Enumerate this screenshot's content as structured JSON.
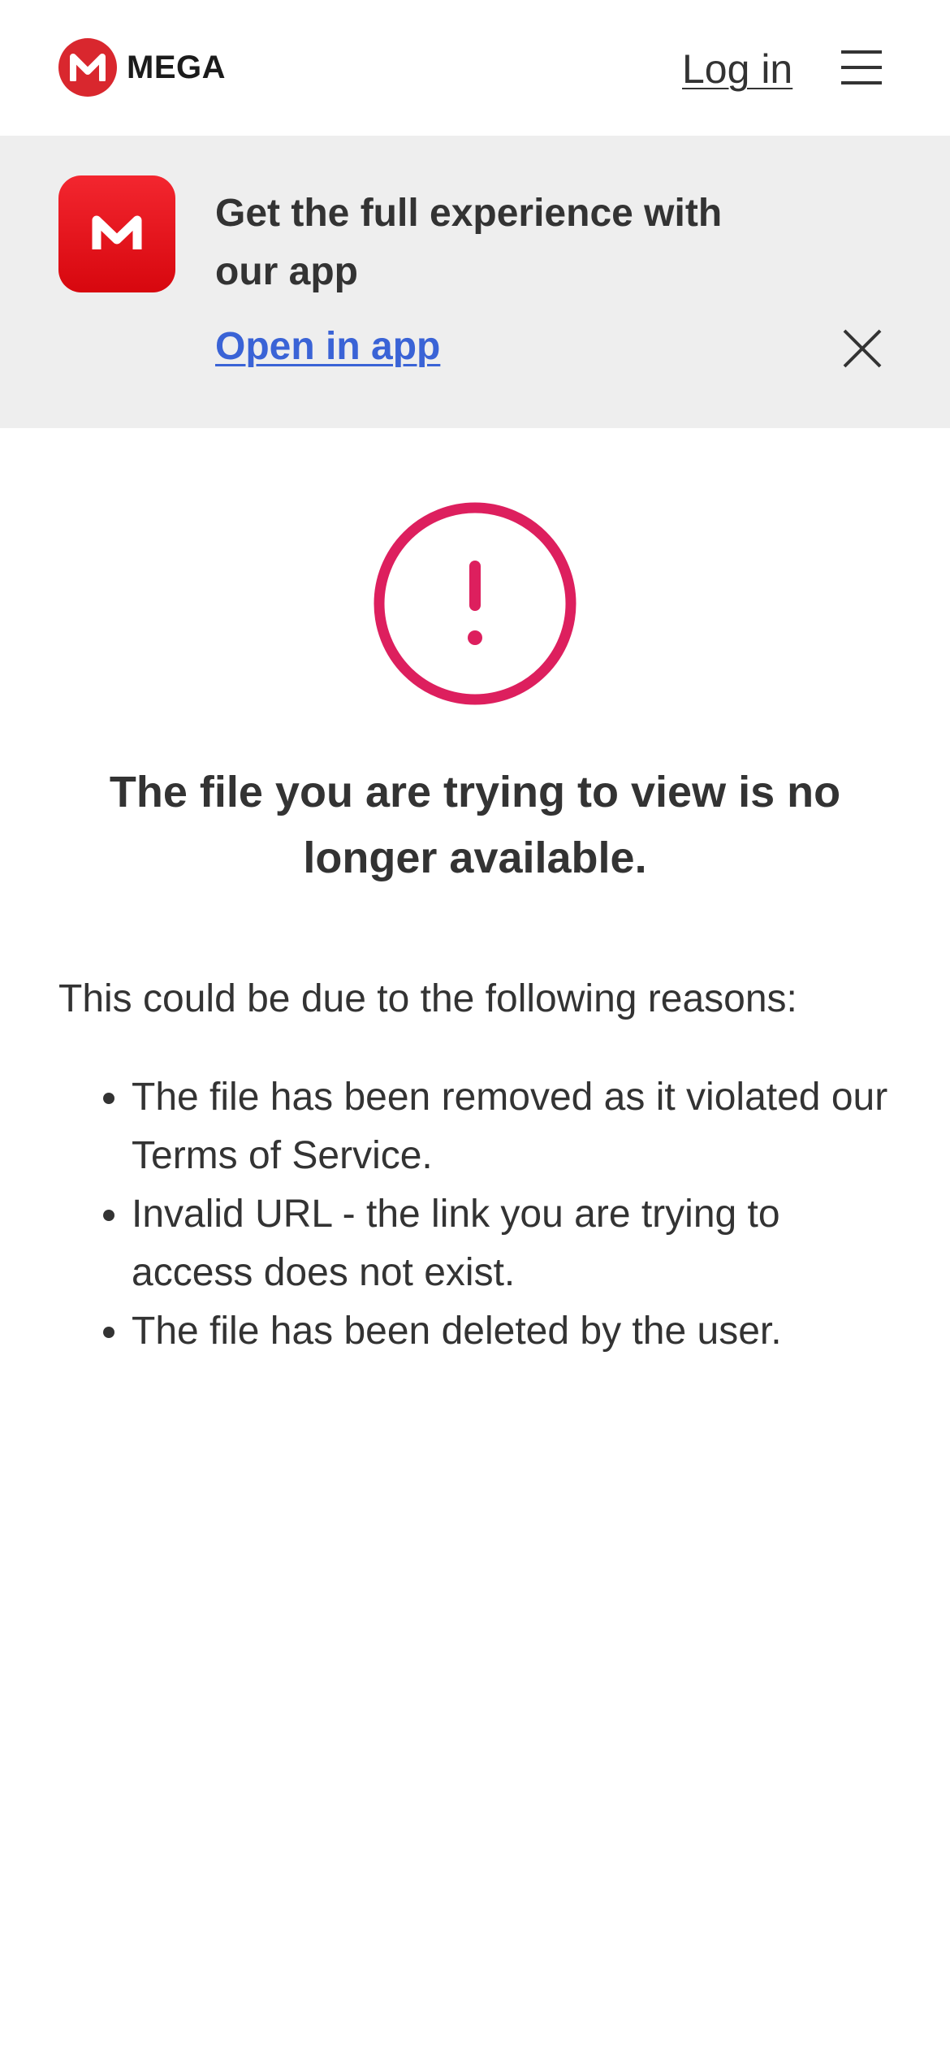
{
  "header": {
    "brand": "MEGA",
    "login_label": "Log in"
  },
  "banner": {
    "message": "Get the full experience with our app",
    "open_app_label": "Open in app"
  },
  "main": {
    "title": "The file you are trying to view is no longer available.",
    "intro": "This could be due to the following reasons:",
    "reasons": [
      "The file has been removed as it violated our Terms of Service.",
      "Invalid URL - the link you are trying to access does not exist.",
      "The file has been deleted by the user."
    ]
  },
  "icons": {
    "logo": "mega-logo-icon",
    "menu": "hamburger-menu-icon",
    "app": "mega-app-icon",
    "close": "close-icon",
    "alert": "exclamation-circle-icon"
  },
  "colors": {
    "brand_red": "#d9272e",
    "alert_pink": "#dd1f5e",
    "link_blue": "#3a63d6",
    "banner_bg": "#eeeeee",
    "text": "#333333"
  }
}
